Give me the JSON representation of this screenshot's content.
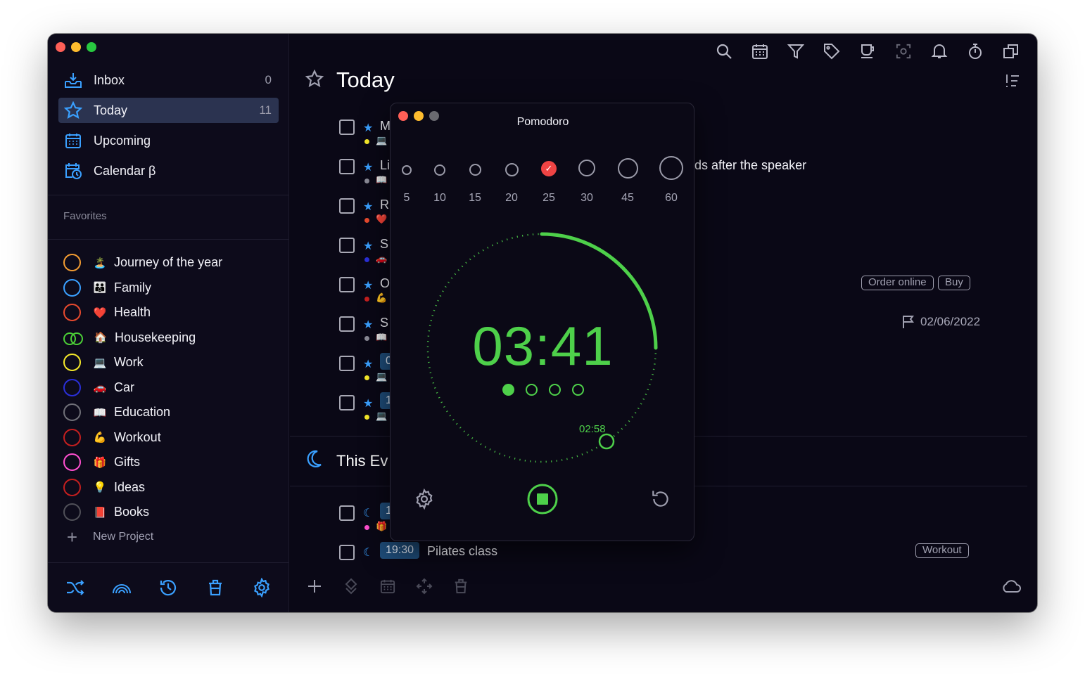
{
  "sidebar": {
    "nav": [
      {
        "label": "Inbox",
        "count": "0"
      },
      {
        "label": "Today",
        "count": "11"
      },
      {
        "label": "Upcoming",
        "count": ""
      },
      {
        "label": "Calendar β",
        "count": ""
      }
    ],
    "favorites_title": "Favorites",
    "projects": [
      {
        "name": "Journey of the year",
        "emoji": "🏝️",
        "color": "#f39c32"
      },
      {
        "name": "Family",
        "emoji": "👪",
        "color": "#3aa0ff"
      },
      {
        "name": "Health",
        "emoji": "❤️",
        "color": "#e84a2e"
      },
      {
        "name": "Housekeeping",
        "emoji": "🏠",
        "color": "#4cd137"
      },
      {
        "name": "Work",
        "emoji": "💻",
        "color": "#f5e92a"
      },
      {
        "name": "Car",
        "emoji": "🚗",
        "color": "#2a2fd8"
      },
      {
        "name": "Education",
        "emoji": "📖",
        "color": "#707078"
      },
      {
        "name": "Workout",
        "emoji": "💪",
        "color": "#c41f1f"
      },
      {
        "name": "Gifts",
        "emoji": "🎁",
        "color": "#ff4fd0"
      },
      {
        "name": "Ideas",
        "emoji": "💡",
        "color": "#c41f1f"
      },
      {
        "name": "Books",
        "emoji": "📕",
        "color": "#505058"
      }
    ],
    "new_project": "New Project"
  },
  "main": {
    "title": "Today",
    "tasks": [
      {
        "title": "M",
        "dot": "#f5e92a",
        "emoji": "💻"
      },
      {
        "title": "Li",
        "dot": "#8a8a96",
        "emoji": "📖",
        "rest": "ds after the speaker"
      },
      {
        "title": "R",
        "dot": "#e84a2e",
        "emoji": "❤️"
      },
      {
        "title": "S",
        "dot": "#2a2fd8",
        "emoji": "🚗"
      },
      {
        "title": "O",
        "dot": "#c41f1f",
        "emoji": "💪"
      },
      {
        "title": "S",
        "dot": "#8a8a96",
        "emoji": "📖"
      },
      {
        "time": "0",
        "dot": "#f5e92a",
        "emoji": "💻"
      },
      {
        "time": "1",
        "dot": "#f5e92a",
        "emoji": "💻"
      }
    ],
    "tags": {
      "order": "Order online",
      "buy": "Buy",
      "workout": "Workout"
    },
    "deadline": "02/06/2022",
    "section_title": "This Ev",
    "evening_tasks": [
      {
        "time": "1",
        "dot": "#ff4fd0",
        "emoji": "🎁"
      },
      {
        "time": "19:30",
        "title": "Pilates class"
      }
    ]
  },
  "pomodoro": {
    "title": "Pomodoro",
    "durations": [
      "5",
      "10",
      "15",
      "20",
      "25",
      "30",
      "45",
      "60"
    ],
    "selected_duration": "25",
    "timer": "03:41",
    "sub_time": "02:58",
    "sessions_total": 4,
    "sessions_done": 1,
    "accent": "#4ed04a"
  }
}
